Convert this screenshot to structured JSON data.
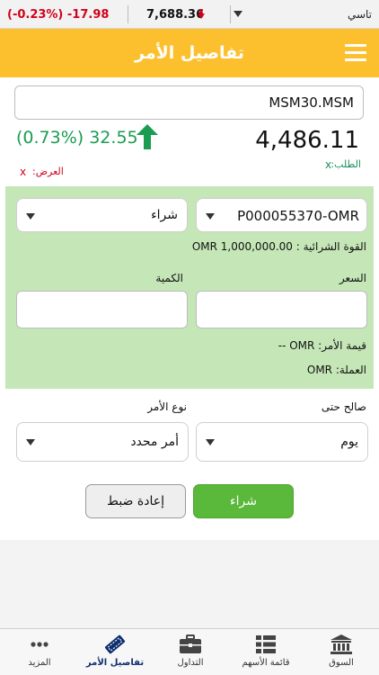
{
  "ticker": {
    "change": "(-0.23%) -17.98",
    "index_value": "7,688.36",
    "market_name": "تاسي",
    "down_color": "#d0021b"
  },
  "header": {
    "title": "تفاصيل الأمر",
    "menu_icon": "hamburger-menu-icon",
    "color": "#fcc02e"
  },
  "quote": {
    "symbol": "MSM30.MSM",
    "change": "(0.73%) 32.55",
    "last_price": "4,486.11",
    "bid_label": "الطلب:",
    "bid_value": "x",
    "ask_label": "العرض:",
    "ask_value": "x",
    "up_color": "#1a9c52"
  },
  "order": {
    "account": "P000055370-OMR",
    "side": "شراء",
    "buying_power": "القوة الشرائية : OMR 1,000,000.00",
    "price_label": "السعر",
    "price_value": "",
    "quantity_label": "الكمية",
    "quantity_value": "",
    "order_value": "قيمة الأمر: OMR --",
    "currency": "العملة: OMR",
    "validity_label": "صالح حتى",
    "validity_value": "يوم",
    "order_type_label": "نوع الأمر",
    "order_type_value": "أمر محدد",
    "panel_color": "#c5e6b7"
  },
  "actions": {
    "buy": "شراء",
    "reset": "إعادة ضبط",
    "buy_color": "#5ab83a"
  },
  "tabbar": {
    "tabs": [
      {
        "label": "السوق",
        "icon": "bank-icon"
      },
      {
        "label": "قائمة الأسهم",
        "icon": "list-icon"
      },
      {
        "label": "التداول",
        "icon": "briefcase-icon"
      },
      {
        "label": "تفاصيل الأمر",
        "icon": "ticket-icon",
        "active": true
      },
      {
        "label": "المزيد",
        "icon": "more-dots-icon"
      }
    ]
  }
}
